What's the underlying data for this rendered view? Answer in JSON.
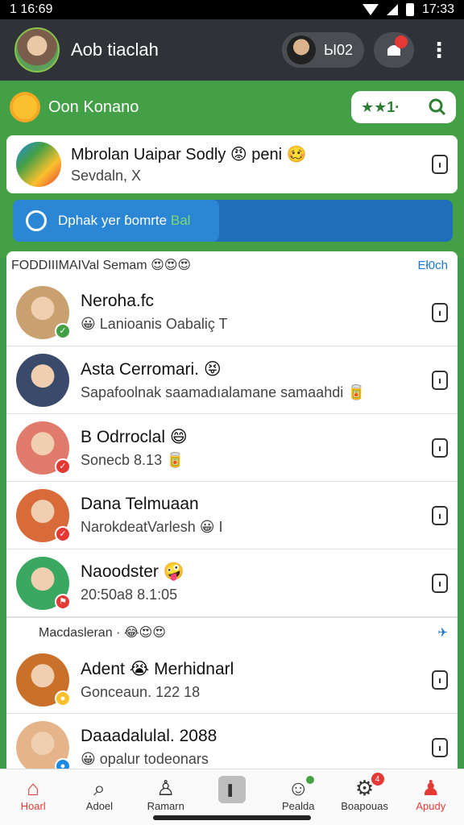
{
  "status_bar": {
    "time_left": "1 16:69",
    "time_right": "17:33"
  },
  "app_bar": {
    "title": "Aob tiaclah",
    "pill_text": "Ы02"
  },
  "search": {
    "label": "Oon Konano",
    "box_text": "★★1·"
  },
  "pinned": {
    "title": "Mbrolan Uaipar Sodly 😡 peni 🥴",
    "subtitle": "Sevdaln, X"
  },
  "banner": {
    "text": "Dphak yer ɓomrte",
    "accent": "Bal"
  },
  "section1": {
    "title": "FODDIIIMAIVal Semam 😍😍😍",
    "action": "Eł0ch"
  },
  "chats1": [
    {
      "name": "Neroha.fc",
      "message": "😀 Lanioanis Oabaliç T",
      "avatar_color": "#c9a070",
      "badge_color": "#43a047",
      "badge_glyph": "✓"
    },
    {
      "name": "Asta Cerromari. 😝",
      "message": "Sapafoolnak saamadıalamane samaahdi 🥫",
      "avatar_color": "#3a4a6a",
      "badge_color": "",
      "badge_glyph": ""
    },
    {
      "name": "B Odrroclal 😄",
      "message": "Sonecb 8.13 🥫",
      "avatar_color": "#e07a6a",
      "badge_color": "#e53935",
      "badge_glyph": "✓"
    },
    {
      "name": "Dana Telmuaan",
      "message": "NarokdeatVarlesh 😀 I",
      "avatar_color": "#d96a3a",
      "badge_color": "#e53935",
      "badge_glyph": "✓"
    },
    {
      "name": "Naoodster 🤪",
      "message": "20:50a8 8.1:05",
      "avatar_color": "#3aa860",
      "badge_color": "#e53935",
      "badge_glyph": "⚑"
    }
  ],
  "section2": {
    "title": "Macdasleran · 😂😍😍",
    "action": "✈"
  },
  "chats2": [
    {
      "name": "Adent 😭 Merhidnarl",
      "message": "Gonceaun. 122 18",
      "avatar_color": "#c9702a",
      "badge_color": "#fbc02d",
      "badge_glyph": "●"
    },
    {
      "name": "Daaadalulal. 2088",
      "message": "😀 opalur todeonars",
      "avatar_color": "#e6b48a",
      "badge_color": "#1e88e5",
      "badge_glyph": "●"
    }
  ],
  "bottom_nav": [
    {
      "label": "Hoarl",
      "glyph": "⌂",
      "active": true
    },
    {
      "label": "Adoel",
      "glyph": "⌕",
      "active": false
    },
    {
      "label": "Ramarn",
      "glyph": "♙",
      "active": false
    },
    {
      "label": "",
      "glyph": "▌",
      "active": false
    },
    {
      "label": "Pealda",
      "glyph": "☺",
      "active": false
    },
    {
      "label": "Boapouas",
      "glyph": "⚙",
      "active": false,
      "count": "4"
    },
    {
      "label": "Apudy",
      "glyph": "♟",
      "active": true
    }
  ]
}
